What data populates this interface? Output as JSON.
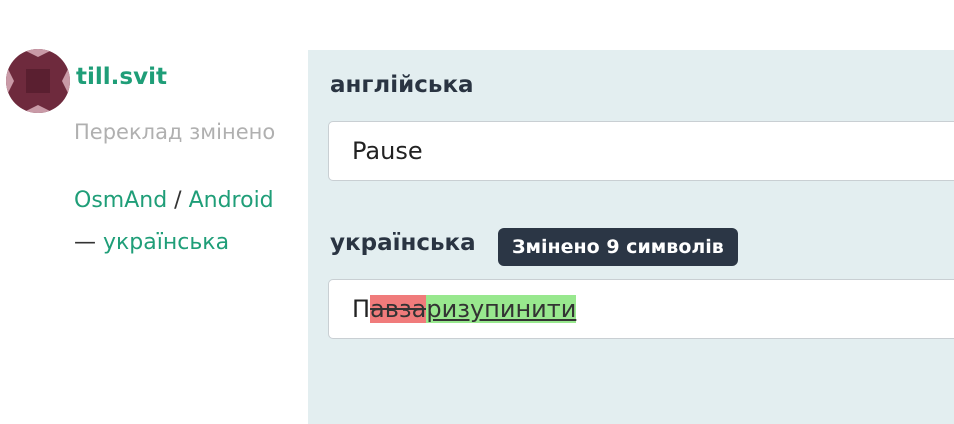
{
  "user": {
    "name": "till.svit",
    "avatar_color": "#6e2a3d"
  },
  "action": {
    "text": "Переклад змінено"
  },
  "project": {
    "name": "OsmAnd",
    "separator": "/",
    "component": "Android",
    "dash": "—",
    "language": "українська"
  },
  "source": {
    "label": "англійська",
    "value": "Pause"
  },
  "target": {
    "label": "українська",
    "badge": "Змінено 9 символів",
    "diff": {
      "unchanged": "П",
      "deleted": "авза",
      "inserted": "ризупинити"
    }
  },
  "colors": {
    "link": "#1f9e78",
    "panel_bg": "#e3eef0",
    "badge_bg": "#2b3645",
    "diff_deleted_bg": "#f07b7b",
    "diff_inserted_bg": "#98e88e"
  }
}
